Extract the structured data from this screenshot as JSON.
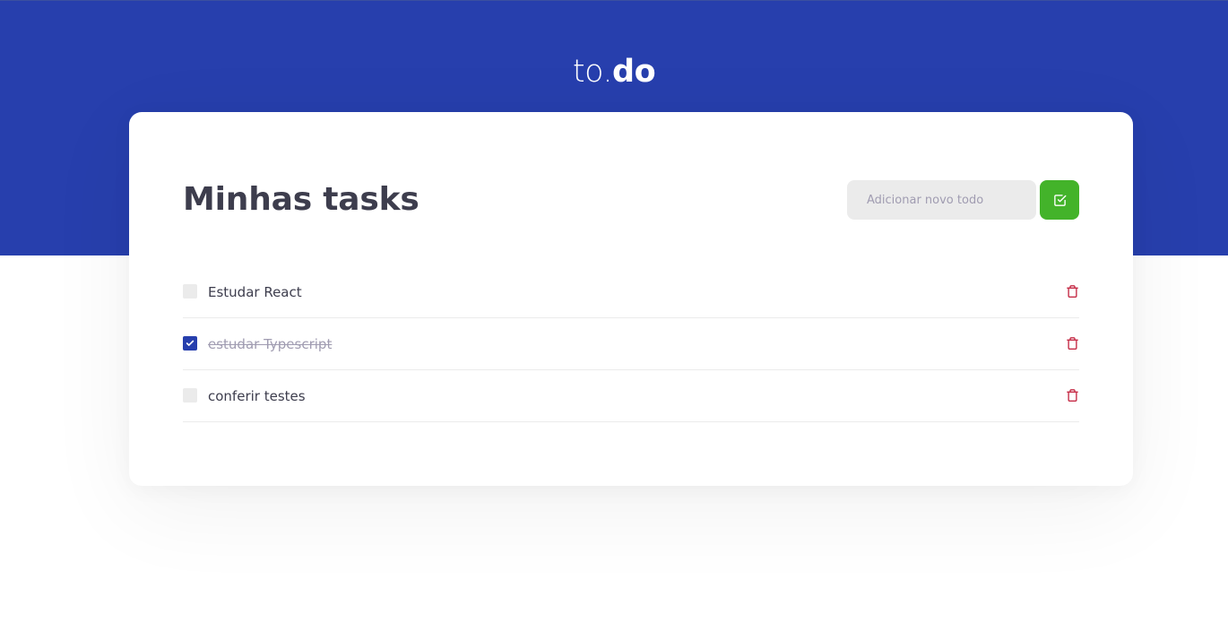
{
  "header": {
    "logo_light": "to.",
    "logo_bold": "do"
  },
  "main": {
    "title": "Minhas tasks",
    "new_todo": {
      "placeholder": "Adicionar novo todo",
      "value": ""
    },
    "add_button_icon": "check-square-icon"
  },
  "tasks": [
    {
      "title": "Estudar React",
      "done": false
    },
    {
      "title": "estudar Typescript",
      "done": true
    },
    {
      "title": "conferir testes",
      "done": false
    }
  ],
  "icons": {
    "delete": "trash-icon",
    "checkbox_checked": "check-icon"
  },
  "colors": {
    "brand_blue": "#273FAD",
    "add_green": "#43B32A",
    "delete_red": "#C52A45",
    "title_text": "#3D3D4D",
    "input_bg": "#EBEBEB",
    "muted_text": "#A09CB1"
  }
}
